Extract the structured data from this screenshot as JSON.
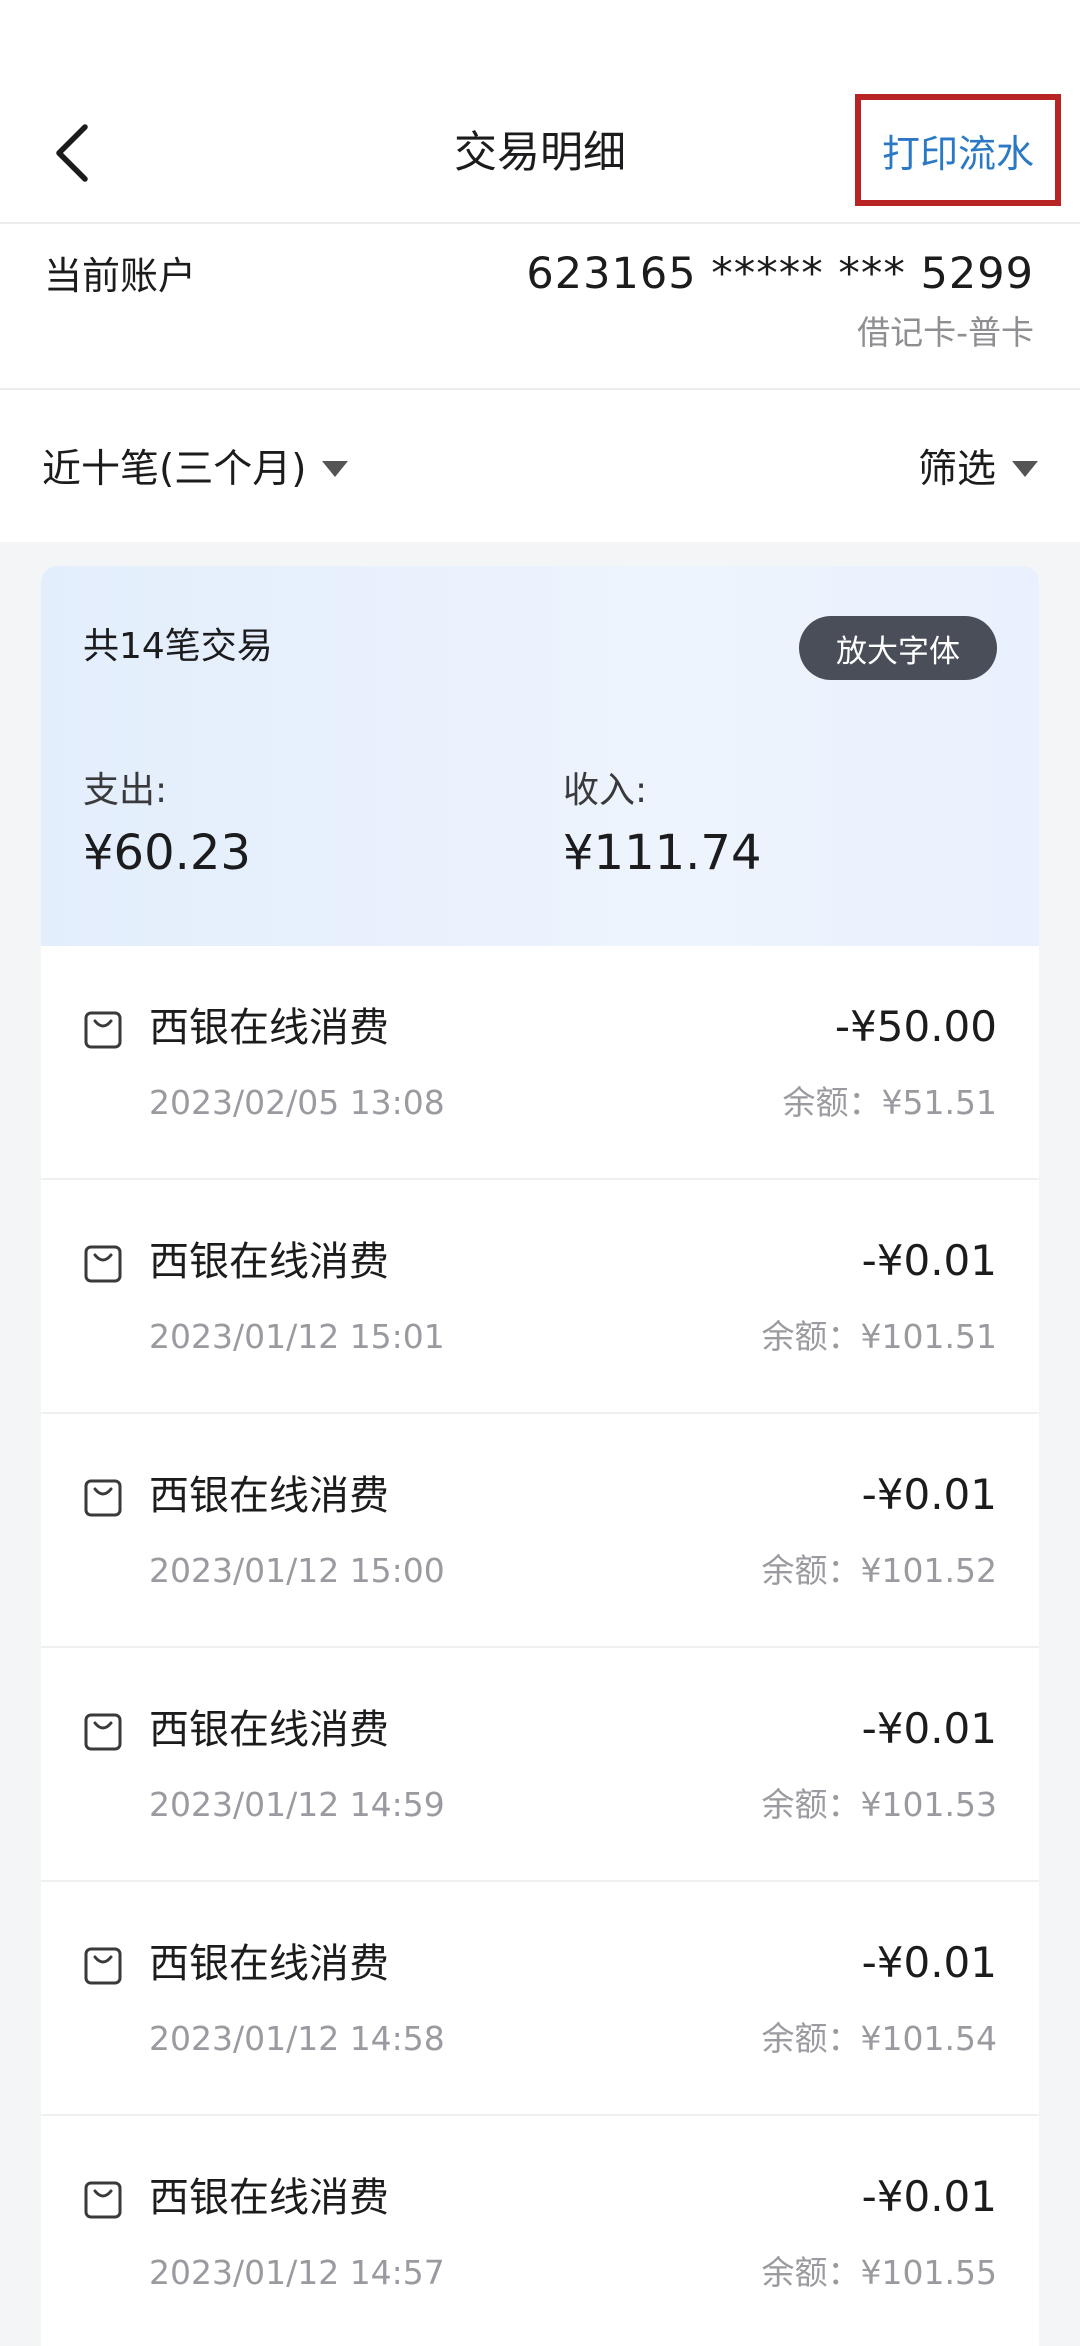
{
  "header": {
    "title": "交易明细",
    "print_label": "打印流水"
  },
  "account": {
    "label": "当前账户",
    "number": "623165 ***** *** 5299",
    "type": "借记卡-普卡"
  },
  "filters": {
    "period": "近十笔(三个月)",
    "filter_label": "筛选"
  },
  "summary": {
    "count_text": "共14笔交易",
    "font_button": "放大字体",
    "expense_label": "支出:",
    "expense_value": "¥60.23",
    "income_label": "收入:",
    "income_value": "¥111.74"
  },
  "transactions": [
    {
      "merchant": "西银在线消费",
      "amount": "-¥50.00",
      "date": "2023/02/05 13:08",
      "balance": "余额：¥51.51"
    },
    {
      "merchant": "西银在线消费",
      "amount": "-¥0.01",
      "date": "2023/01/12 15:01",
      "balance": "余额：¥101.51"
    },
    {
      "merchant": "西银在线消费",
      "amount": "-¥0.01",
      "date": "2023/01/12 15:00",
      "balance": "余额：¥101.52"
    },
    {
      "merchant": "西银在线消费",
      "amount": "-¥0.01",
      "date": "2023/01/12 14:59",
      "balance": "余额：¥101.53"
    },
    {
      "merchant": "西银在线消费",
      "amount": "-¥0.01",
      "date": "2023/01/12 14:58",
      "balance": "余额：¥101.54"
    },
    {
      "merchant": "西银在线消费",
      "amount": "-¥0.01",
      "date": "2023/01/12 14:57",
      "balance": "余额：¥101.55"
    }
  ],
  "icons": {
    "back": "chevron-left-icon",
    "dropdown": "caret-down-icon",
    "transaction": "shopping-bag-icon"
  },
  "colors": {
    "link_blue": "#2b79c4",
    "highlight_red": "#b82323",
    "summary_bg": "#e3eefc",
    "font_button_bg": "#4a4e59"
  }
}
